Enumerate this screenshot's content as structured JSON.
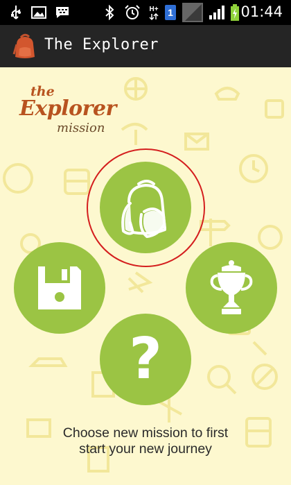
{
  "status_bar": {
    "time": "01:44",
    "network_label": "H+",
    "sim_badge": "1",
    "icons": [
      "usb-icon",
      "image-icon",
      "bbm-icon",
      "bluetooth-icon",
      "alarm-icon",
      "data-transfer-icon",
      "sim-icon",
      "no-signal-icon",
      "signal-icon",
      "battery-charging-icon"
    ]
  },
  "app_bar": {
    "title": "The Explorer",
    "icon": "backpack-icon"
  },
  "logo": {
    "the": "the",
    "word": "Explorer",
    "mission": "mission"
  },
  "menu": {
    "new_mission_icon": "backpack-icon",
    "load_icon": "floppy-disk-icon",
    "trophy_icon": "trophy-icon",
    "help_icon": "question-mark-icon",
    "help_glyph": "?"
  },
  "caption": {
    "line1": "Choose new mission to first",
    "line2": "start your new journey"
  },
  "colors": {
    "background": "#fdf8cf",
    "accent_green": "#9bc444",
    "highlight_ring": "#d41e1e",
    "app_bar": "#252525",
    "logo_brown": "#b8531f"
  }
}
